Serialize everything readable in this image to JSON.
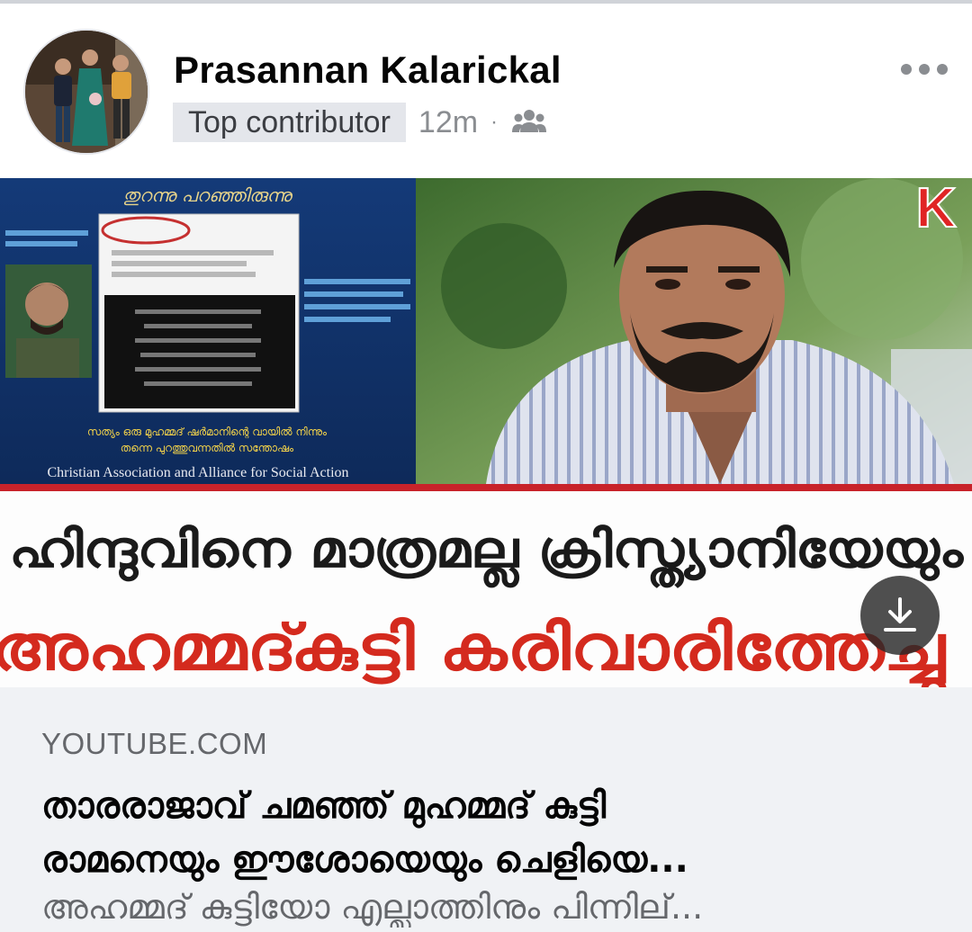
{
  "post": {
    "author_name": "Prasannan Kalarickal",
    "badge": "Top contributor",
    "time": "12m",
    "separator": "·",
    "audience_icon": "group-icon",
    "more_icon": "more-options-icon"
  },
  "thumbnail": {
    "left_panel_top_text": "തുറന്നു പറഞ്ഞിരുന്നു",
    "left_panel_bottom_text_1": "സത്യം ഒരു മുഹമ്മദ് ഷർമാനിന്റെ വായിൽ നിന്നും",
    "left_panel_bottom_text_2": "തന്നെ പുറത്തുവന്നതിൽ സന്തോഷം",
    "organization": "Christian Association and Alliance for Social Action",
    "channel_logo": "K",
    "headline_line_1": "ഹിന്ദുവിനെ മാത്രമല്ല ക്രിസ്ത്യാനിയേയും",
    "headline_line_2": "അഹമ്മദ്കുട്ടി കരിവാരിത്തേച്ചു",
    "download_icon": "download-icon"
  },
  "link_preview": {
    "domain": "YOUTUBE.COM",
    "title_line_1": "താരരാജാവ് ചമഞ്ഞ് മുഹമ്മദ് കുട്ടി",
    "title_line_2": "രാമനെയും ഈശോയെയും ചെളിയെ...",
    "description": "അഹമ്മദ് കുട്ടിയോ എല്ലാത്തിനും പിന്നില്..."
  },
  "colors": {
    "headline_red": "#d42a1e",
    "divider_red": "#c8232a",
    "badge_bg": "#e4e6eb",
    "preview_bg": "#f0f2f5"
  }
}
